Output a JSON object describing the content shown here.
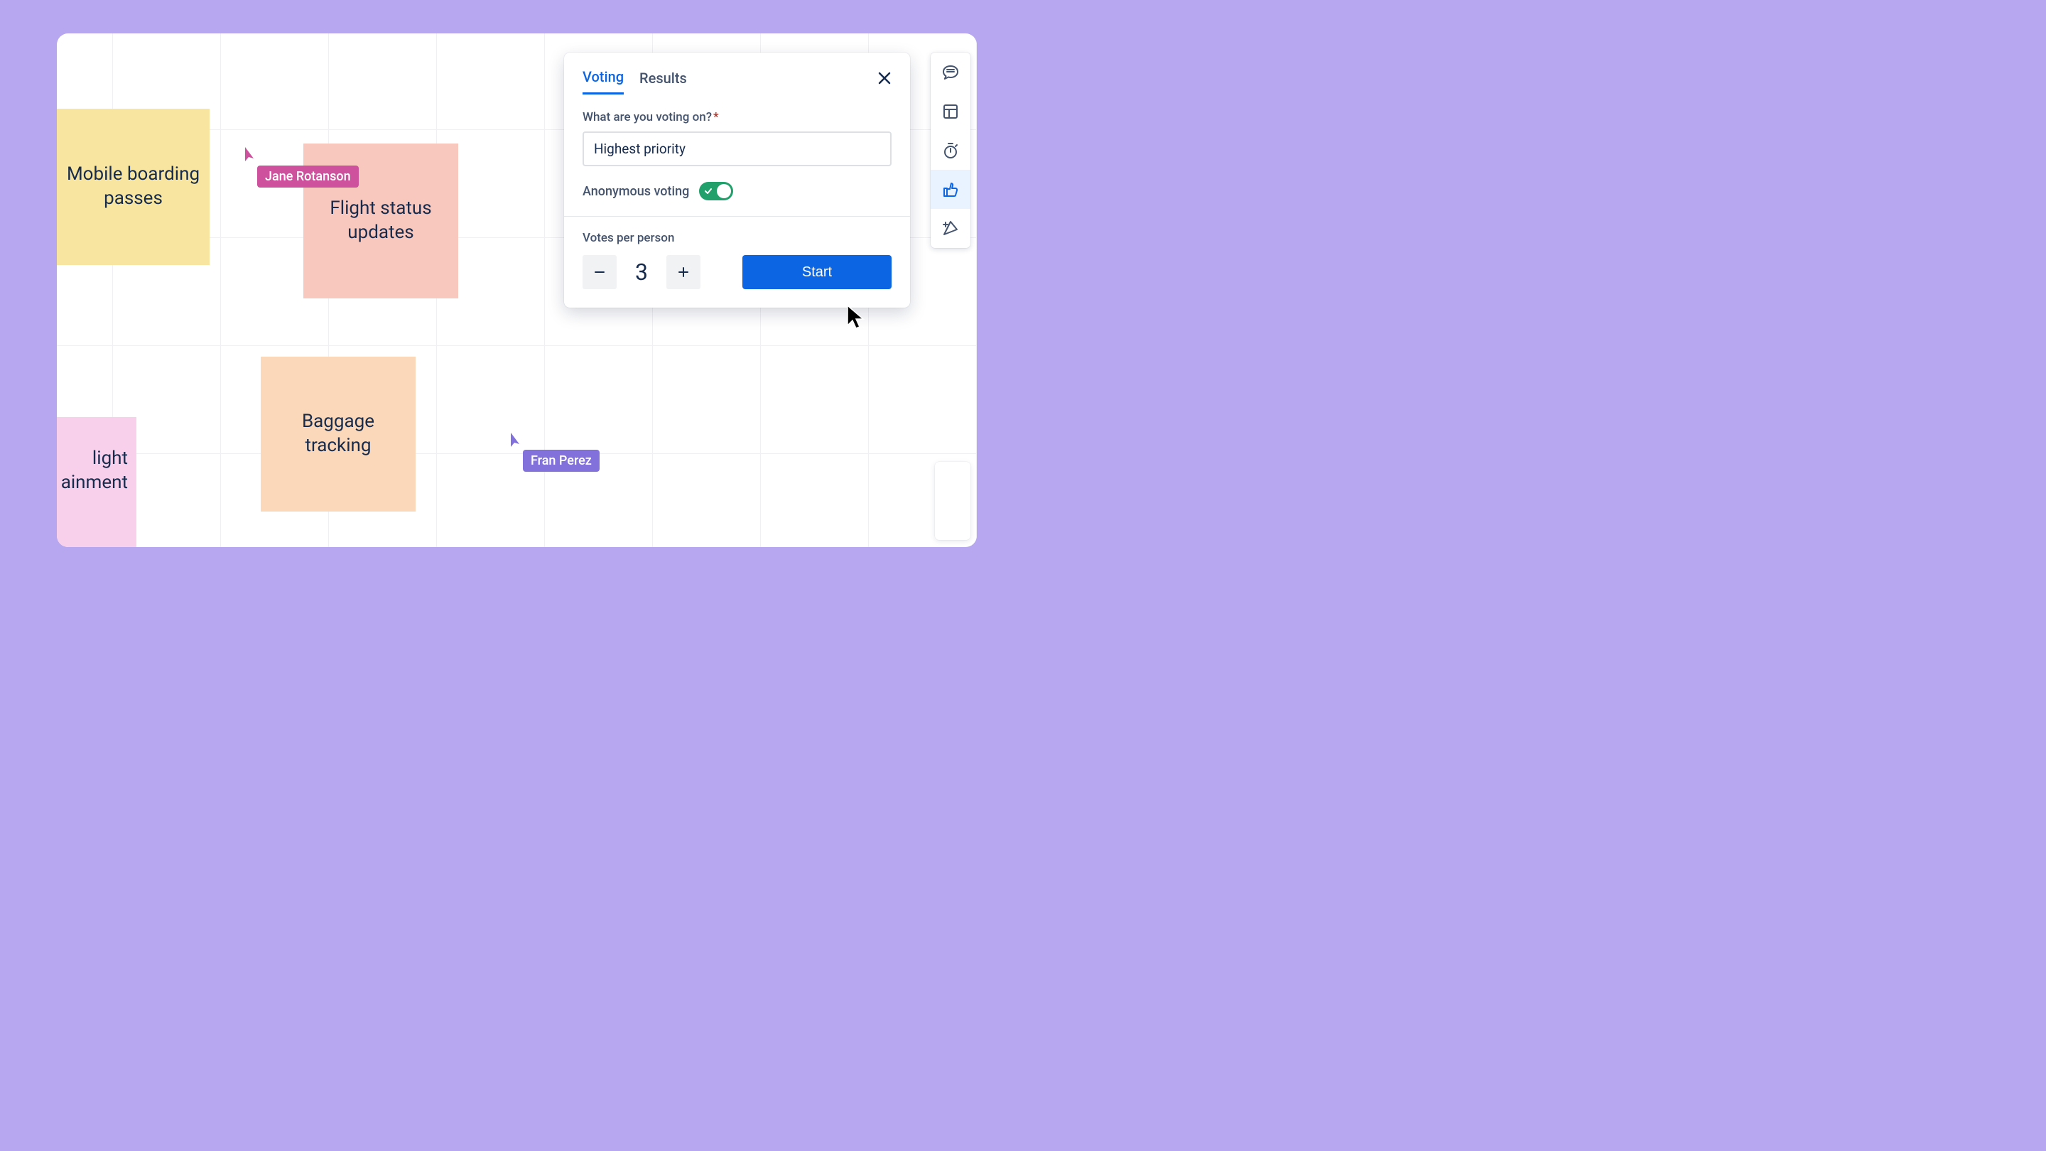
{
  "stickies": {
    "yellow": "Mobile boarding passes",
    "pink1": "Flight status updates",
    "pink2": "light\nainment",
    "orange": "Baggage tracking"
  },
  "cursors": {
    "jane": "Jane Rotanson",
    "fran": "Fran Perez"
  },
  "panel": {
    "tabs": {
      "voting": "Voting",
      "results": "Results"
    },
    "question_label": "What are you voting on?",
    "question_value": "Highest priority",
    "anon_label": "Anonymous voting",
    "votes_label": "Votes per person",
    "votes_value": "3",
    "start": "Start"
  }
}
